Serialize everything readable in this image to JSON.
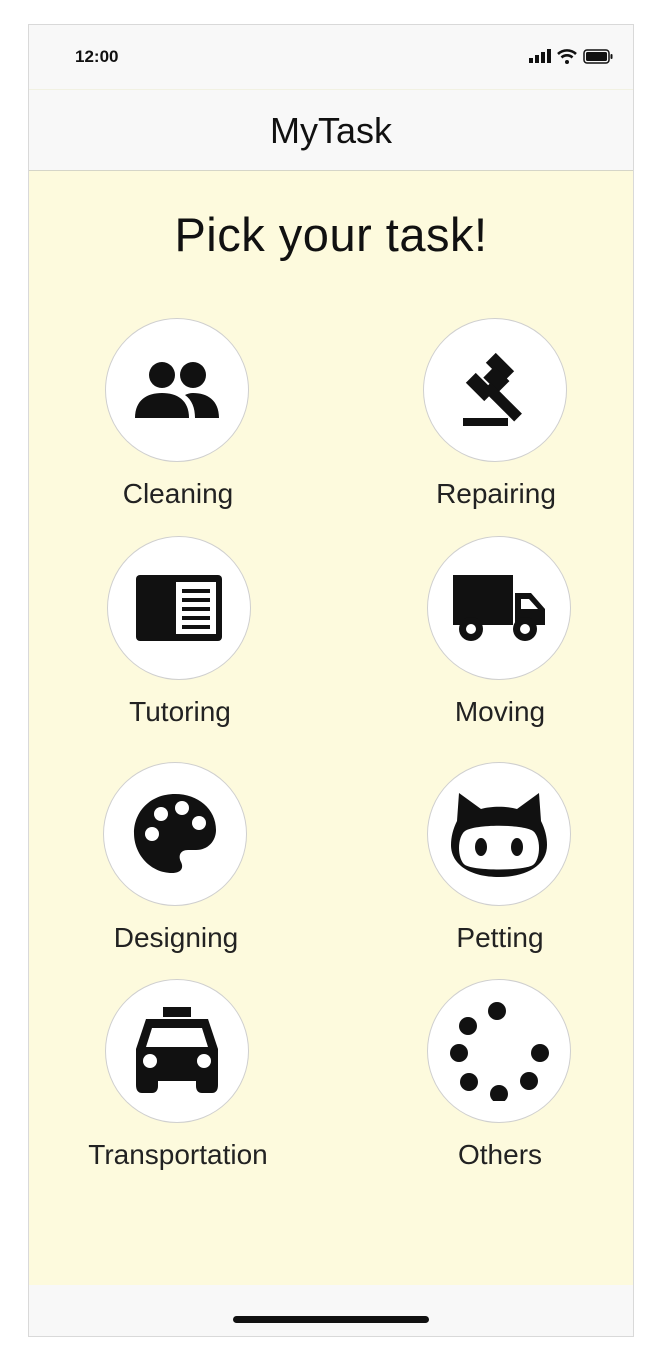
{
  "status_bar": {
    "time": "12:00",
    "icons": [
      "signal-icon",
      "wifi-icon",
      "battery-icon"
    ]
  },
  "nav": {
    "title": "MyTask"
  },
  "main": {
    "heading": "Pick your task!",
    "tasks": [
      {
        "label": "Cleaning",
        "icon": "people-icon"
      },
      {
        "label": "Repairing",
        "icon": "gavel-icon"
      },
      {
        "label": "Tutoring",
        "icon": "book-icon"
      },
      {
        "label": "Moving",
        "icon": "truck-icon"
      },
      {
        "label": "Designing",
        "icon": "palette-icon"
      },
      {
        "label": "Petting",
        "icon": "cat-icon"
      },
      {
        "label": "Transportation",
        "icon": "taxi-icon"
      },
      {
        "label": "Others",
        "icon": "dots-icon"
      }
    ]
  },
  "colors": {
    "content_bg": "#fdfadd",
    "bar_bg": "#f8f8f8",
    "icon": "#111111"
  }
}
